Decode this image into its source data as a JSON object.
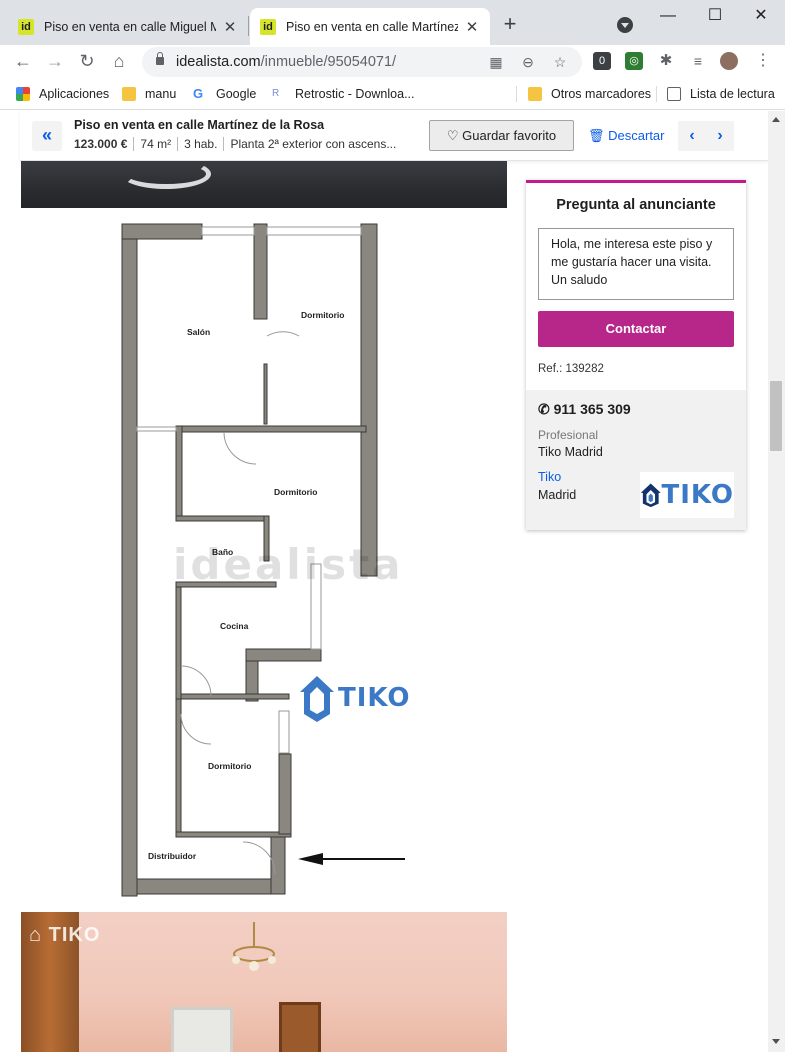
{
  "browser": {
    "tabs": [
      {
        "title": "Piso en venta en calle Miguel Mo",
        "favicon": "id",
        "active": false
      },
      {
        "title": "Piso en venta en calle Martínez d",
        "favicon": "id",
        "active": true
      }
    ],
    "new_tab": "+",
    "window_controls": [
      "—",
      "☐",
      "✕"
    ],
    "url_domain": "idealista.com",
    "url_path": "/inmueble/95054071/",
    "bookmarks": [
      {
        "label": "Aplicaciones",
        "icon": "apps-grid-icon"
      },
      {
        "label": "manu",
        "icon": "folder-icon"
      },
      {
        "label": "Google",
        "icon": "google-icon"
      },
      {
        "label": "Retrostic - Downloa...",
        "icon": "retrostic-icon"
      },
      {
        "label": "Otros marcadores",
        "icon": "folder-icon"
      },
      {
        "label": "Lista de lectura",
        "icon": "reading-list-icon"
      }
    ]
  },
  "listing_header": {
    "title": "Piso en venta en calle Martínez de la Rosa",
    "price": "123.000 €",
    "size": "74 m²",
    "rooms": "3 hab.",
    "floor": "Planta 2ª exterior con ascens...",
    "favorite_label": "Guardar favorito",
    "discard_label": "Descartar"
  },
  "floorplan": {
    "rooms": [
      "Salón",
      "Dormitorio",
      "Dormitorio",
      "Baño",
      "Cocina",
      "Dormitorio",
      "Distribuidor"
    ],
    "watermark": "idealista",
    "brand": "TIKO"
  },
  "photo2": {
    "brand": "TIKO"
  },
  "contact": {
    "title": "Pregunta al anunciante",
    "message": "Hola, me interesa este piso y me gustaría hacer una visita. Un saludo",
    "button": "Contactar",
    "ref": "Ref.: 139282",
    "phone": "911 365 309",
    "profile_type": "Profesional",
    "agency": "Tiko Madrid",
    "agent_name": "Tiko",
    "city": "Madrid",
    "logo_text": "TIKO"
  },
  "colors": {
    "brand_magenta": "#b72789",
    "link_blue": "#0c5ce7",
    "tiko_blue": "#3b78c5",
    "wall_gray": "#8a8680"
  }
}
